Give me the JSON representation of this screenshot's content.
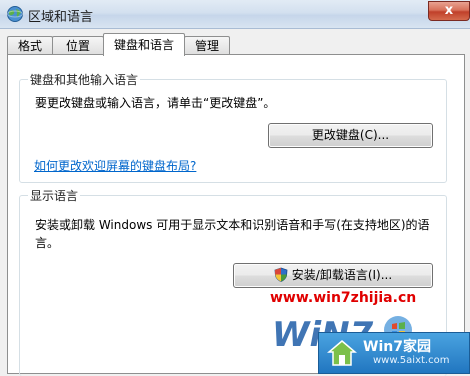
{
  "window": {
    "title": "区域和语言",
    "close_label": "x"
  },
  "tabs": [
    {
      "label": "格式"
    },
    {
      "label": "位置"
    },
    {
      "label": "键盘和语言"
    },
    {
      "label": "管理"
    }
  ],
  "keyboard_group": {
    "label": "键盘和其他输入语言",
    "description": "要更改键盘或输入语言，请单击“更改键盘”。",
    "button_label": "更改键盘(C)...",
    "link_text": "如何更改欢迎屏幕的键盘布局?"
  },
  "display_group": {
    "label": "显示语言",
    "description_line1": "安装或卸载 Windows 可用于显示文本和识别语音和手写(在支持地区)的语",
    "description_line2": "言。",
    "button_label": "安装/卸载语言(I)..."
  },
  "watermark": {
    "url": "www.win7zhijia.cn",
    "logo_text": "WiN7",
    "badge_title": "Win7家园",
    "badge_url": "www.5aixt.com"
  },
  "colors": {
    "link": "#0066cc",
    "watermark_red": "#e00000",
    "badge_blue": "#2176c0"
  }
}
